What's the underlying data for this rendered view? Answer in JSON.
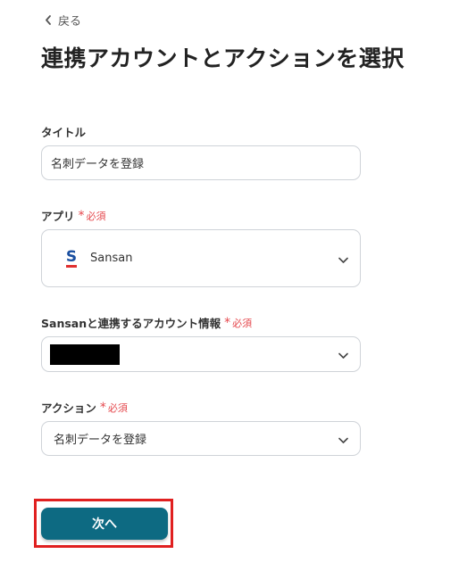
{
  "header": {
    "back_label": "戻る",
    "title": "連携アカウントとアクションを選択"
  },
  "form": {
    "title_field": {
      "label": "タイトル",
      "value": "名刺データを登録"
    },
    "app_field": {
      "label": "アプリ",
      "required_label": "必須",
      "value": "Sansan",
      "icon": "sansan-logo"
    },
    "account_field": {
      "label": "Sansanと連携するアカウント情報",
      "required_label": "必須",
      "value_redacted": true
    },
    "action_field": {
      "label": "アクション",
      "required_label": "必須",
      "value": "名刺データを登録"
    }
  },
  "footer": {
    "next_label": "次へ"
  },
  "colors": {
    "primary_button": "#0d6a82",
    "required": "#e5484d",
    "highlight_border": "#e02020",
    "sansan_blue": "#1a4fa0",
    "sansan_red": "#e03030"
  }
}
